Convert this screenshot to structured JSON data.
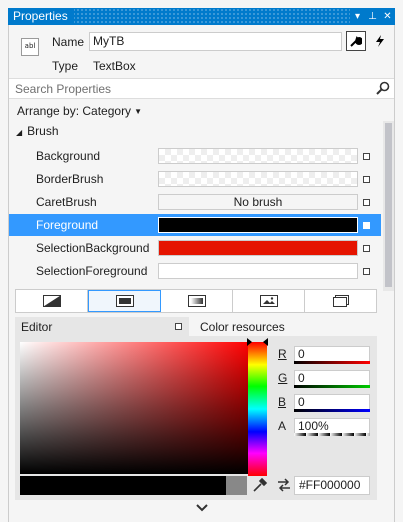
{
  "window": {
    "title": "Properties"
  },
  "header": {
    "icon_text": "abl",
    "name_label": "Name",
    "name_value": "MyTB",
    "type_label": "Type",
    "type_value": "TextBox"
  },
  "search": {
    "placeholder": "Search Properties"
  },
  "arrange": {
    "label": "Arrange by: Category"
  },
  "category": {
    "label": "Brush"
  },
  "properties": [
    {
      "label": "Background",
      "value": ""
    },
    {
      "label": "BorderBrush",
      "value": ""
    },
    {
      "label": "CaretBrush",
      "value": "No brush"
    },
    {
      "label": "Foreground",
      "value": "",
      "color": "#000000"
    },
    {
      "label": "SelectionBackground",
      "value": "",
      "color": "#e51400"
    },
    {
      "label": "SelectionForeground",
      "value": "",
      "color": "#ffffff"
    }
  ],
  "editor": {
    "title": "Editor",
    "color_resources": "Color resources",
    "channels": [
      {
        "letter": "R",
        "value": "0"
      },
      {
        "letter": "G",
        "value": "0"
      },
      {
        "letter": "B",
        "value": "0"
      },
      {
        "letter": "A",
        "value": "100%"
      }
    ],
    "hex": "#FF000000"
  },
  "colors": {
    "accent": "#007acc",
    "selection": "#3399ff"
  }
}
